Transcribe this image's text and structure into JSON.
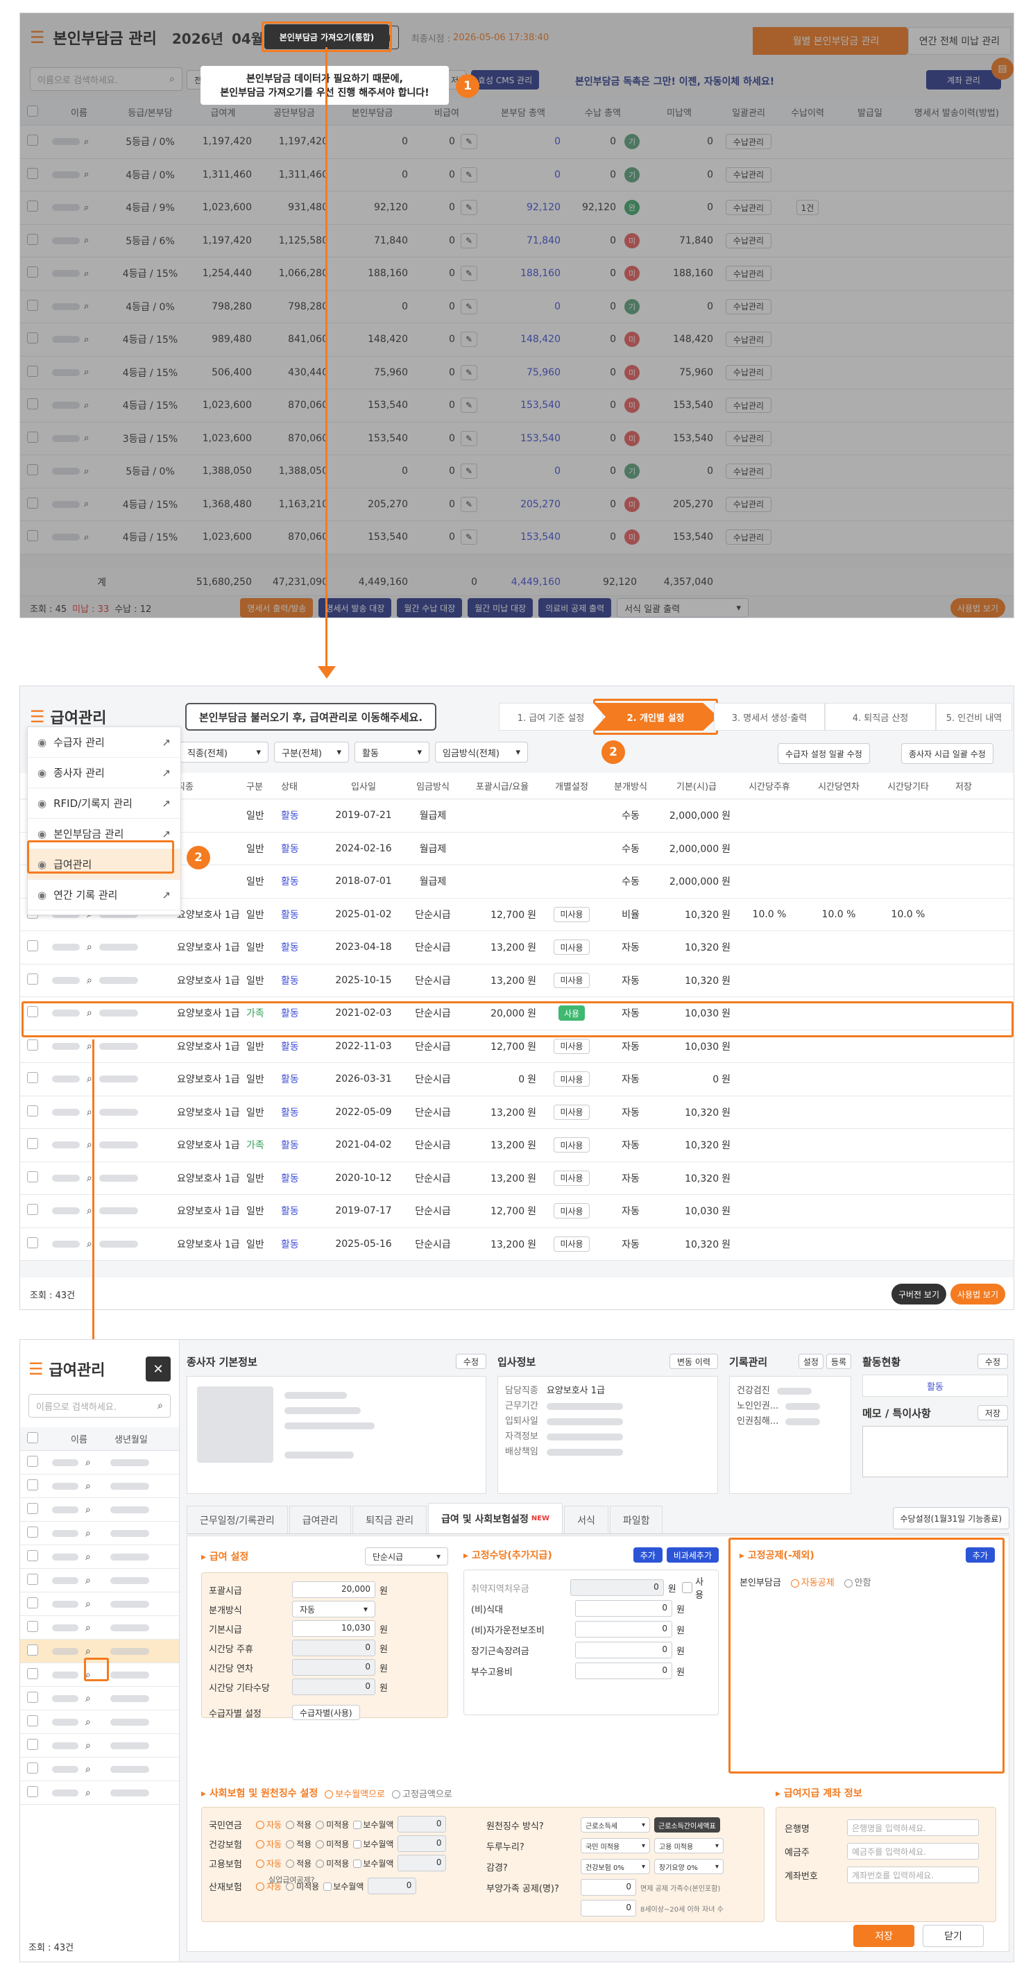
{
  "top": {
    "title": "본인부담금 관리",
    "year": "2026년",
    "month": "04월",
    "import_btn": "본인부담금 가져오기(통합)",
    "last_sync_label": "최종시점 :",
    "last_sync": "2026-05-06 17:38:40",
    "tab_monthly": "월별 본인부담금 관리",
    "tab_annual": "연간 전체 미납 관리",
    "search_placeholder": "이름으로 검색하세요.",
    "callout_line1": "본인부담금 데이터가 필요하기 때문에,",
    "callout_line2": "본인부담금 가져오기를 우선 진행 해주셔야 합니다!",
    "cms_btn": "효성 CMS 관리",
    "cms_promo": "본인부담금 독촉은 그만! 이젠, 자동이체 하세요!",
    "account_btn": "계좌 관리",
    "left_stub": "전",
    "mid_stub": "저",
    "headers": [
      "이름",
      "등급/본부담",
      "급여계",
      "공단부담금",
      "본인부담금",
      "비급여",
      "본부담 총액",
      "수납 총액",
      "미납액",
      "일괄관리",
      "수납이력",
      "발급일",
      "명세서 발송이력(방법)"
    ],
    "rows": [
      {
        "grade": "5등급 / 0%",
        "total": "1,197,420",
        "gov": "1,197,420",
        "self": "0",
        "non": "0",
        "due": "0",
        "paid": "0",
        "tag": "기",
        "unpaid": "0",
        "hist": ""
      },
      {
        "grade": "4등급 / 0%",
        "total": "1,311,460",
        "gov": "1,311,460",
        "self": "0",
        "non": "0",
        "due": "0",
        "paid": "0",
        "tag": "기",
        "unpaid": "0",
        "hist": ""
      },
      {
        "grade": "4등급 / 9%",
        "total": "1,023,600",
        "gov": "931,480",
        "self": "92,120",
        "non": "0",
        "due": "92,120",
        "paid": "92,120",
        "tag": "완",
        "unpaid": "0",
        "hist": "1건"
      },
      {
        "grade": "5등급 / 6%",
        "total": "1,197,420",
        "gov": "1,125,580",
        "self": "71,840",
        "non": "0",
        "due": "71,840",
        "paid": "0",
        "tag": "미",
        "unpaid": "71,840",
        "hist": ""
      },
      {
        "grade": "4등급 / 15%",
        "total": "1,254,440",
        "gov": "1,066,280",
        "self": "188,160",
        "non": "0",
        "due": "188,160",
        "paid": "0",
        "tag": "미",
        "unpaid": "188,160",
        "hist": ""
      },
      {
        "grade": "4등급 / 0%",
        "total": "798,280",
        "gov": "798,280",
        "self": "0",
        "non": "0",
        "due": "0",
        "paid": "0",
        "tag": "기",
        "unpaid": "0",
        "hist": ""
      },
      {
        "grade": "4등급 / 15%",
        "total": "989,480",
        "gov": "841,060",
        "self": "148,420",
        "non": "0",
        "due": "148,420",
        "paid": "0",
        "tag": "미",
        "unpaid": "148,420",
        "hist": ""
      },
      {
        "grade": "4등급 / 15%",
        "total": "506,400",
        "gov": "430,440",
        "self": "75,960",
        "non": "0",
        "due": "75,960",
        "paid": "0",
        "tag": "미",
        "unpaid": "75,960",
        "hist": ""
      },
      {
        "grade": "4등급 / 15%",
        "total": "1,023,600",
        "gov": "870,060",
        "self": "153,540",
        "non": "0",
        "due": "153,540",
        "paid": "0",
        "tag": "미",
        "unpaid": "153,540",
        "hist": ""
      },
      {
        "grade": "3등급 / 15%",
        "total": "1,023,600",
        "gov": "870,060",
        "self": "153,540",
        "non": "0",
        "due": "153,540",
        "paid": "0",
        "tag": "미",
        "unpaid": "153,540",
        "hist": ""
      },
      {
        "grade": "5등급 / 0%",
        "total": "1,388,050",
        "gov": "1,388,050",
        "self": "0",
        "non": "0",
        "due": "0",
        "paid": "0",
        "tag": "기",
        "unpaid": "0",
        "hist": ""
      },
      {
        "grade": "4등급 / 15%",
        "total": "1,368,480",
        "gov": "1,163,210",
        "self": "205,270",
        "non": "0",
        "due": "205,270",
        "paid": "0",
        "tag": "미",
        "unpaid": "205,270",
        "hist": ""
      },
      {
        "grade": "4등급 / 15%",
        "total": "1,023,600",
        "gov": "870,060",
        "self": "153,540",
        "non": "0",
        "due": "153,540",
        "paid": "0",
        "tag": "미",
        "unpaid": "153,540",
        "hist": ""
      }
    ],
    "receive_btn": "수납관리",
    "total_label": "계",
    "totals": {
      "total": "51,680,250",
      "gov": "47,231,090",
      "self": "4,449,160",
      "non": "0",
      "due": "4,449,160",
      "paid": "92,120",
      "unpaid": "4,357,040"
    },
    "footer_count": "조회 : 45",
    "footer_unpaid": "미납 : 33",
    "footer_paid": "수납 : 12",
    "footer_btns": [
      "명세서 출력/발송",
      "명세서 발송 대장",
      "월간 수납 대장",
      "월간 미납 대장",
      "의료비 공제 출력"
    ],
    "bulk_print": "서식 일괄 출력",
    "usage_btn": "사용법 보기"
  },
  "mid": {
    "title": "급여관리",
    "callout": "본인부담금 불러오기 후, 급여관리로 이동해주세요.",
    "steps": [
      "1. 급여 기준 설정",
      "2. 개인별 설정",
      "3. 명세서 생성·출력",
      "4. 퇴직금 산정",
      "5. 인건비 내역"
    ],
    "menu": [
      "수급자 관리",
      "종사자 관리",
      "RFID/기록지 관리",
      "본인부담금 관리",
      "급여관리",
      "연간 기록 관리"
    ],
    "filters": [
      "직종(전체)",
      "구분(전체)",
      "활동",
      "임금방식(전체)"
    ],
    "bulk_btn1": "수급자 설정 일괄 수정",
    "bulk_btn2": "종사자 시급 일괄 수정",
    "headers": [
      "직종",
      "구분",
      "상태",
      "입사일",
      "임금방식",
      "포괄시급/요율",
      "개별설정",
      "분개방식",
      "기본(시)급",
      "시간당주휴",
      "시간당연차",
      "시간당기타",
      "저장"
    ],
    "rows": [
      {
        "job": "",
        "div": "일반",
        "st": "활동",
        "date": "2019-07-21",
        "pay": "월급제",
        "rate": "",
        "ind": "",
        "split": "수동",
        "base": "2,000,000",
        "unit": "원",
        "w": "",
        "a": "",
        "e": ""
      },
      {
        "job": "",
        "div": "일반",
        "st": "활동",
        "date": "2024-02-16",
        "pay": "월급제",
        "rate": "",
        "ind": "",
        "split": "수동",
        "base": "2,000,000",
        "unit": "원",
        "w": "",
        "a": "",
        "e": ""
      },
      {
        "job": "",
        "div": "일반",
        "st": "활동",
        "date": "2018-07-01",
        "pay": "월급제",
        "rate": "",
        "ind": "",
        "split": "수동",
        "base": "2,000,000",
        "unit": "원",
        "w": "",
        "a": "",
        "e": ""
      },
      {
        "job": "요양보호사 1급",
        "div": "일반",
        "st": "활동",
        "date": "2025-01-02",
        "pay": "단순시급",
        "rate": "12,700",
        "ind": "미사용",
        "split": "비율",
        "base": "10,320",
        "unit": "원",
        "w": "10.0 %",
        "a": "10.0 %",
        "e": "10.0 %"
      },
      {
        "job": "요양보호사 1급",
        "div": "일반",
        "st": "활동",
        "date": "2023-04-18",
        "pay": "단순시급",
        "rate": "13,200",
        "ind": "미사용",
        "split": "자동",
        "base": "10,320",
        "unit": "원",
        "w": "",
        "a": "",
        "e": ""
      },
      {
        "job": "요양보호사 1급",
        "div": "일반",
        "st": "활동",
        "date": "2025-10-15",
        "pay": "단순시급",
        "rate": "13,200",
        "ind": "미사용",
        "split": "자동",
        "base": "10,320",
        "unit": "원",
        "w": "",
        "a": "",
        "e": ""
      },
      {
        "job": "요양보호사 1급",
        "div": "가족",
        "st": "활동",
        "date": "2021-02-03",
        "pay": "단순시급",
        "rate": "20,000",
        "ind": "사용",
        "split": "자동",
        "base": "10,030",
        "unit": "원",
        "w": "",
        "a": "",
        "e": ""
      },
      {
        "job": "요양보호사 1급",
        "div": "일반",
        "st": "활동",
        "date": "2022-11-03",
        "pay": "단순시급",
        "rate": "12,700",
        "ind": "미사용",
        "split": "자동",
        "base": "10,030",
        "unit": "원",
        "w": "",
        "a": "",
        "e": ""
      },
      {
        "job": "요양보호사 1급",
        "div": "일반",
        "st": "활동",
        "date": "2026-03-31",
        "pay": "단순시급",
        "rate": "0",
        "ind": "미사용",
        "split": "자동",
        "base": "0",
        "unit": "원",
        "w": "",
        "a": "",
        "e": ""
      },
      {
        "job": "요양보호사 1급",
        "div": "일반",
        "st": "활동",
        "date": "2022-05-09",
        "pay": "단순시급",
        "rate": "13,200",
        "ind": "미사용",
        "split": "자동",
        "base": "10,320",
        "unit": "원",
        "w": "",
        "a": "",
        "e": ""
      },
      {
        "job": "요양보호사 1급",
        "div": "가족",
        "st": "활동",
        "date": "2021-04-02",
        "pay": "단순시급",
        "rate": "13,200",
        "ind": "미사용",
        "split": "자동",
        "base": "10,320",
        "unit": "원",
        "w": "",
        "a": "",
        "e": ""
      },
      {
        "job": "요양보호사 1급",
        "div": "일반",
        "st": "활동",
        "date": "2020-10-12",
        "pay": "단순시급",
        "rate": "13,200",
        "ind": "미사용",
        "split": "자동",
        "base": "10,320",
        "unit": "원",
        "w": "",
        "a": "",
        "e": ""
      },
      {
        "job": "요양보호사 1급",
        "div": "일반",
        "st": "활동",
        "date": "2019-07-17",
        "pay": "단순시급",
        "rate": "12,700",
        "ind": "미사용",
        "split": "자동",
        "base": "10,030",
        "unit": "원",
        "w": "",
        "a": "",
        "e": ""
      },
      {
        "job": "요양보호사 1급",
        "div": "일반",
        "st": "활동",
        "date": "2025-05-16",
        "pay": "단순시급",
        "rate": "13,200",
        "ind": "미사용",
        "split": "자동",
        "base": "10,320",
        "unit": "원",
        "w": "",
        "a": "",
        "e": ""
      }
    ],
    "won": "원",
    "footer_count": "조회 : 43건",
    "old_btn": "구버전 보기",
    "usage_btn": "사용법 보기"
  },
  "bot": {
    "title": "급여관리",
    "search_placeholder": "이름으로 검색하세요.",
    "col_name": "이름",
    "col_birth": "생년월일",
    "footer_count": "조회 : 43건",
    "basic_info": "종사자 기본정보",
    "edit": "수정",
    "join_info": "입사정보",
    "change_hist": "변동 이력",
    "job_label": "담당직종",
    "job_value": "요양보호사 1급",
    "join_labels": [
      "근무기간",
      "입퇴사일",
      "자격정보",
      "배상책임"
    ],
    "record_mgmt": "기록관리",
    "settings": "설정",
    "register": "등록",
    "record_items": [
      "건강검진",
      "노인인권...",
      "인권침해..."
    ],
    "activity": "활동현황",
    "activity_value": "활동",
    "memo": "메모 / 특이사항",
    "save_small": "저장",
    "tabs": [
      "근무일정/기록관리",
      "급여관리",
      "퇴직금 관리",
      "급여 및 사회보험설정",
      "서식",
      "파일함"
    ],
    "new_badge": "NEW",
    "allowance_btn": "수당설정(1월31일 기능종료)",
    "pay_setting": "급여 설정",
    "pay_type": "단순시급",
    "pay_fields": [
      {
        "label": "포괄시급",
        "value": "20,000"
      },
      {
        "label": "분개방식",
        "value": "자동"
      },
      {
        "label": "기본시급",
        "value": "10,030"
      },
      {
        "label": "시간당 주휴",
        "value": "0"
      },
      {
        "label": "시간당 연차",
        "value": "0"
      },
      {
        "label": "시간당 기타수당",
        "value": "0"
      }
    ],
    "care_setting": "수급자별 설정",
    "care_btn": "수급자별(사용)",
    "fixed_allow": "고정수당(추가지급)",
    "add": "추가",
    "nontax_add": "비과세추가",
    "allow_fields": [
      {
        "label": "취약지역처우금",
        "value": "0"
      },
      {
        "label": "(비)식대",
        "value": "0"
      },
      {
        "label": "(비)자가운전보조비",
        "value": "0"
      },
      {
        "label": "장기근속장려금",
        "value": "0"
      },
      {
        "label": "부수고용비",
        "value": "0"
      }
    ],
    "use_label": "사용",
    "fixed_ded": "고정공제(-제외)",
    "ded_label": "본인부담금",
    "ded_opt1": "자동공제",
    "ded_opt2": "안함",
    "social": "사회보험 및 원천징수 설정",
    "social_opt1": "보수월액으로",
    "social_opt2": "고정금액으로",
    "ins_rows": [
      {
        "label": "국민연금",
        "a": "자동",
        "b": "적용",
        "c": "미적용",
        "d": "보수월액"
      },
      {
        "label": "건강보험",
        "a": "자동",
        "b": "적용",
        "c": "미적용",
        "d": "보수월액"
      },
      {
        "label": "고용보험",
        "a": "자동",
        "b": "적용",
        "c": "미적용",
        "d": "보수월액"
      },
      {
        "label": "산재보험",
        "a": "자동",
        "b": "",
        "c": "미적용",
        "d": "보수월액"
      }
    ],
    "unemp_note": "실업급여공제?",
    "withhold": "원천징수 방식?",
    "withhold_sel": "근로소득세",
    "withhold_btn": "근로소득간이세액표",
    "dual": "두루누리?",
    "dual_sel1": "국민 미적용",
    "dual_sel2": "고용 미적용",
    "reduce": "감경?",
    "reduce_sel1": "건강보험 0%",
    "reduce_sel2": "장기요양 0%",
    "dependents": "부양가족 공제(명)?",
    "dep_note1": "면제 공제 가족수(본인포함)",
    "dep_note2": "8세이상~20세 이하 자녀 수",
    "bank_section": "급여지급 계좌 정보",
    "bank_fields": [
      {
        "label": "은행명",
        "ph": "은행명을 입력하세요."
      },
      {
        "label": "예금주",
        "ph": "예금주를 입력하세요."
      },
      {
        "label": "계좌번호",
        "ph": "계좌번호를 입력하세요."
      }
    ],
    "save_btn": "저장",
    "close_btn": "닫기",
    "zero": "0",
    "won": "원"
  }
}
